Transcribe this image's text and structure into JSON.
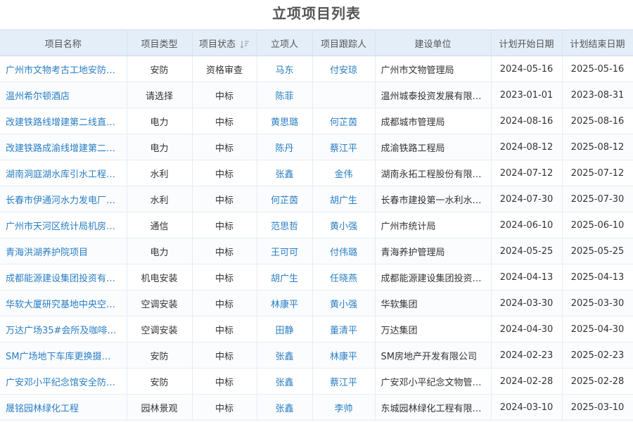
{
  "page": {
    "title": "立项项目列表"
  },
  "columns": [
    {
      "label": "项目名称"
    },
    {
      "label": "项目类型"
    },
    {
      "label": "项目状态"
    },
    {
      "label": "立项人"
    },
    {
      "label": "项目跟踪人"
    },
    {
      "label": "建设单位"
    },
    {
      "label": "计划开始日期"
    },
    {
      "label": "计划结束日期"
    }
  ],
  "rows": [
    {
      "name": "广州市文物考古工地安防…",
      "type": "安防",
      "status": "资格审查",
      "creator": "马东",
      "tracker": "付安琼",
      "unit": "广州市文物管理局",
      "start": "2024-05-16",
      "end": "2025-05-16"
    },
    {
      "name": "温州希尔顿酒店",
      "type": "请选择",
      "status": "中标",
      "creator": "陈菲",
      "tracker": "",
      "unit": "温州城泰投资发展有限…",
      "start": "2023-01-01",
      "end": "2023-08-31"
    },
    {
      "name": "改建铁路线增建第二线直…",
      "type": "电力",
      "status": "中标",
      "creator": "黄思璐",
      "tracker": "何芷茵",
      "unit": "成都城市管理局",
      "start": "2024-08-16",
      "end": "2025-08-16"
    },
    {
      "name": "改建铁路成渝线增建第二…",
      "type": "电力",
      "status": "中标",
      "creator": "陈丹",
      "tracker": "蔡江平",
      "unit": "成渝铁路工程局",
      "start": "2024-08-12",
      "end": "2025-08-12"
    },
    {
      "name": "湖南洞庭湖水库引水工程…",
      "type": "水利",
      "status": "中标",
      "creator": "张鑫",
      "tracker": "金伟",
      "unit": "湖南永拓工程股份有限…",
      "start": "2024-07-12",
      "end": "2025-07-12"
    },
    {
      "name": "长春市伊通河水力发电厂…",
      "type": "水利",
      "status": "中标",
      "creator": "何芷茵",
      "tracker": "胡广生",
      "unit": "长春市建投第一水利水…",
      "start": "2024-07-30",
      "end": "2025-07-30"
    },
    {
      "name": "广州市天河区统计局机房…",
      "type": "通信",
      "status": "中标",
      "creator": "范思哲",
      "tracker": "黄小强",
      "unit": "广州市统计局",
      "start": "2024-06-10",
      "end": "2025-06-10"
    },
    {
      "name": "青海洪湖养护院项目",
      "type": "电力",
      "status": "中标",
      "creator": "王可可",
      "tracker": "付伟璐",
      "unit": "青海养护管理局",
      "start": "2024-05-25",
      "end": "2025-05-25"
    },
    {
      "name": "成都能源建设集团投资有…",
      "type": "机电安装",
      "status": "中标",
      "creator": "胡广生",
      "tracker": "任晓燕",
      "unit": "成都能源建设集团投资…",
      "start": "2024-04-13",
      "end": "2025-04-13"
    },
    {
      "name": "华软大厦研究基地中央空…",
      "type": "空调安装",
      "status": "中标",
      "creator": "林康平",
      "tracker": "黄小强",
      "unit": "华软集团",
      "start": "2024-03-30",
      "end": "2025-03-30"
    },
    {
      "name": "万达广场35#会所及咖啡…",
      "type": "空调安装",
      "status": "中标",
      "creator": "田静",
      "tracker": "董清平",
      "unit": "万达集团",
      "start": "2024-04-30",
      "end": "2025-04-30"
    },
    {
      "name": "SM广场地下车库更换摄…",
      "type": "安防",
      "status": "中标",
      "creator": "张鑫",
      "tracker": "林康平",
      "unit": "SM房地产开发有限公司",
      "start": "2024-02-23",
      "end": "2025-02-23"
    },
    {
      "name": "广安邓小平纪念馆安全防…",
      "type": "安防",
      "status": "中标",
      "creator": "张鑫",
      "tracker": "蔡江平",
      "unit": "广安邓小平纪念文物管…",
      "start": "2024-02-28",
      "end": "2025-02-28"
    },
    {
      "name": "晟铭园林绿化工程",
      "type": "园林景观",
      "status": "中标",
      "creator": "张鑫",
      "tracker": "李帅",
      "unit": "东城园林绿化工程有限…",
      "start": "2024-03-10",
      "end": "2025-03-10"
    }
  ],
  "icons": {
    "status_sort": "sort-icon"
  },
  "colors": {
    "link": "#2a7ec4",
    "header_bg": "#e3eef9",
    "title": "#555555"
  }
}
